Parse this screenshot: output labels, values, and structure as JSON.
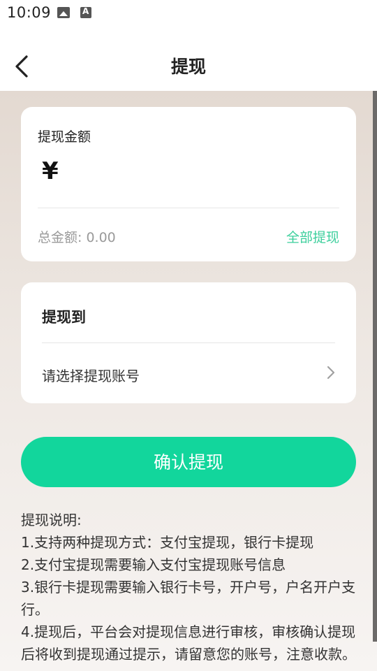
{
  "status_bar": {
    "time": "10:09",
    "icons": [
      "gallery-icon",
      "font-icon"
    ]
  },
  "header": {
    "title": "提现",
    "back_icon": "chevron-left-icon"
  },
  "amount_card": {
    "label": "提现金额",
    "currency_symbol": "¥",
    "input_value": "",
    "total_label": "总金额: 0.00",
    "withdraw_all": "全部提现"
  },
  "destination_card": {
    "title": "提现到",
    "account_placeholder": "请选择提现账号",
    "chevron_icon": "chevron-right-icon"
  },
  "confirm_button": {
    "label": "确认提现"
  },
  "notes": {
    "title": "提现说明:",
    "items": [
      "1.支持两种提现方式：支付宝提现，银行卡提现",
      "2.支付宝提现需要输入支付宝提现账号信息",
      "3.银行卡提现需要输入银行卡号，开户号，户名开户支行。",
      "4.提现后，平台会对提现信息进行审核，审核确认提现后将收到提现通过提示，请留意您的账号，注意收款。"
    ]
  },
  "colors": {
    "accent_green": "#12d69c",
    "link_green": "#3ccf9c",
    "background_top": "#e3d9d1"
  }
}
